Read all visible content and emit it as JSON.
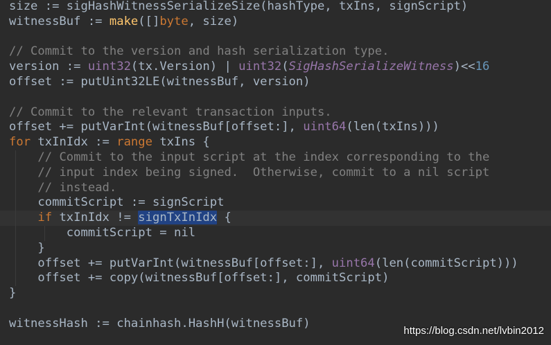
{
  "editor": {
    "lines": [
      [
        {
          "t": "size := sigHashWitnessSerializeSize(hashType, txIns, signScript)"
        }
      ],
      [
        {
          "t": "witnessBuf := "
        },
        {
          "t": "make",
          "c": "fn"
        },
        {
          "t": "([]"
        },
        {
          "t": "byte",
          "c": "kw"
        },
        {
          "t": ", size)"
        }
      ],
      [],
      [
        {
          "t": "// Commit to the version and hash serialization type.",
          "c": "cmt"
        }
      ],
      [
        {
          "t": "version := "
        },
        {
          "t": "uint32",
          "c": "typ"
        },
        {
          "t": "(tx.Version) | "
        },
        {
          "t": "uint32",
          "c": "typ"
        },
        {
          "t": "("
        },
        {
          "t": "SigHashSerializeWitness",
          "c": "const"
        },
        {
          "t": ")<<"
        },
        {
          "t": "16",
          "c": "num"
        }
      ],
      [
        {
          "t": "offset := putUint32LE(witnessBuf, version)"
        }
      ],
      [],
      [
        {
          "t": "// Commit to the relevant transaction inputs.",
          "c": "cmt"
        }
      ],
      [
        {
          "t": "offset += putVarInt(witnessBuf[offset:], "
        },
        {
          "t": "uint64",
          "c": "typ"
        },
        {
          "t": "(len(txIns)))"
        }
      ],
      [
        {
          "t": "for",
          "c": "kw"
        },
        {
          "t": " txInIdx := "
        },
        {
          "t": "range",
          "c": "kw"
        },
        {
          "t": " txIns {"
        }
      ],
      [
        {
          "t": "    "
        },
        {
          "t": "// Commit to the input script at the index corresponding to the",
          "c": "cmt"
        }
      ],
      [
        {
          "t": "    "
        },
        {
          "t": "// input index being signed.  Otherwise, commit to a nil script",
          "c": "cmt"
        }
      ],
      [
        {
          "t": "    "
        },
        {
          "t": "// instead.",
          "c": "cmt"
        }
      ],
      [
        {
          "t": "    commitScript := signScript"
        }
      ],
      [
        {
          "t": "    "
        },
        {
          "t": "if",
          "c": "kw"
        },
        {
          "t": " txInIdx != "
        },
        {
          "t": "signTxInIdx",
          "c": "hl"
        },
        {
          "t": " {"
        }
      ],
      [
        {
          "t": "        commitScript = nil"
        }
      ],
      [
        {
          "t": "    }"
        }
      ],
      [
        {
          "t": "    offset += putVarInt(witnessBuf[offset:], "
        },
        {
          "t": "uint64",
          "c": "typ"
        },
        {
          "t": "(len(commitScript)))"
        }
      ],
      [
        {
          "t": "    offset += copy(witnessBuf[offset:], commitScript)"
        }
      ],
      [
        {
          "t": "}"
        }
      ],
      [],
      [
        {
          "t": "witnessHash := chainhash.HashH(witnessBuf)"
        }
      ]
    ],
    "current_line": 14,
    "highlighted_symbol": "signTxInIdx"
  },
  "watermark": {
    "text": "https://blog.csdn.net/lvbin2012"
  },
  "colors": {
    "background": "#2b2b2b",
    "default_text": "#a9b7c6",
    "keyword": "#cc7832",
    "function": "#ffc66d",
    "number": "#6897bb",
    "comment": "#808080",
    "type": "#9876aa",
    "selection": "#214283"
  }
}
